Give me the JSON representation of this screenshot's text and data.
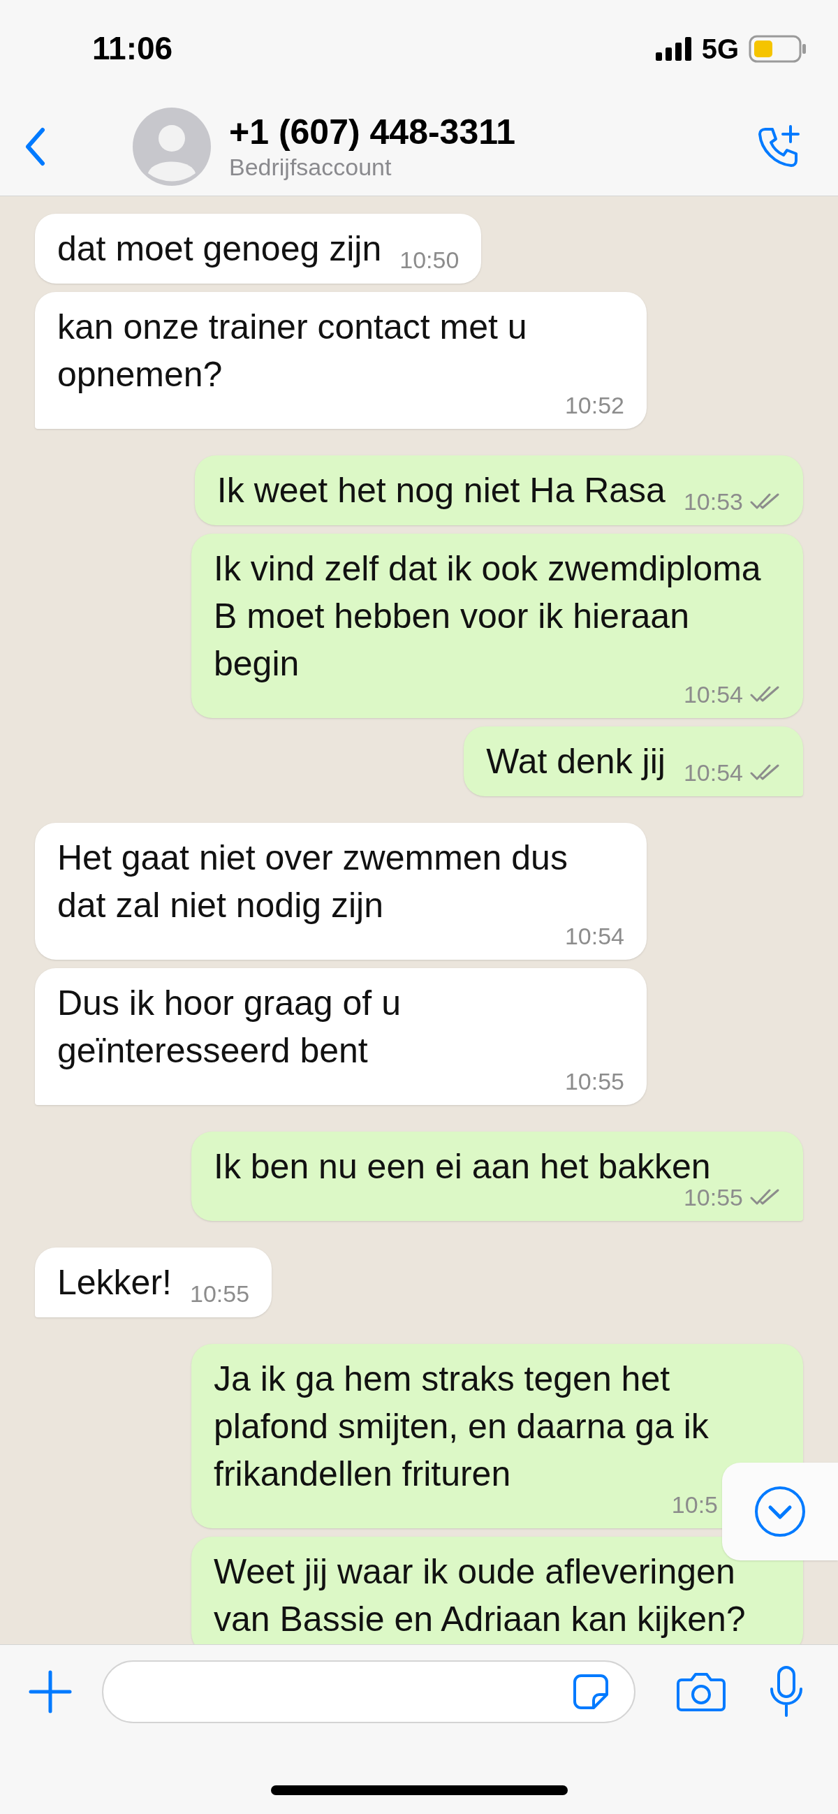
{
  "status_bar": {
    "time": "11:06",
    "network": "5G"
  },
  "header": {
    "title": "+1 (607) 448-3311",
    "subtitle": "Bedrijfsaccount"
  },
  "messages": [
    {
      "kind": "incoming",
      "text": "dat moet genoeg zijn",
      "time": "10:50",
      "tail": false
    },
    {
      "kind": "incoming",
      "text": "kan onze trainer contact met u opnemen?",
      "time": "10:52",
      "tail": true
    },
    {
      "kind": "outgoing",
      "text": "Ik weet het nog niet Ha Rasa",
      "time": "10:53",
      "delivered": true,
      "tail": false
    },
    {
      "kind": "outgoing",
      "text": "Ik vind zelf dat ik ook zwemdiploma B moet hebben voor ik hieraan begin",
      "time": "10:54",
      "delivered": true,
      "tail": false
    },
    {
      "kind": "outgoing",
      "text": "Wat denk jij",
      "time": "10:54",
      "delivered": true,
      "tail": true
    },
    {
      "kind": "incoming",
      "text": "Het gaat niet over zwemmen dus dat zal niet nodig zijn",
      "time": "10:54",
      "tail": false
    },
    {
      "kind": "incoming",
      "text": "Dus ik hoor graag of u geïnteresseerd bent",
      "time": "10:55",
      "tail": true
    },
    {
      "kind": "outgoing",
      "text": "Ik ben nu een ei aan het bakken",
      "time": "10:55",
      "delivered": true,
      "tail": true
    },
    {
      "kind": "incoming",
      "text": "Lekker!",
      "time": "10:55",
      "tail": true
    },
    {
      "kind": "outgoing",
      "text": "Ja ik ga hem straks tegen het plafond smijten, en daarna ga ik frikandellen frituren",
      "time": "10:5",
      "delivered": false,
      "tail": false
    },
    {
      "kind": "outgoing",
      "text": "Weet jij waar ik oude afleveringen van Bassie en Adriaan kan kijken?",
      "tail": false
    }
  ]
}
